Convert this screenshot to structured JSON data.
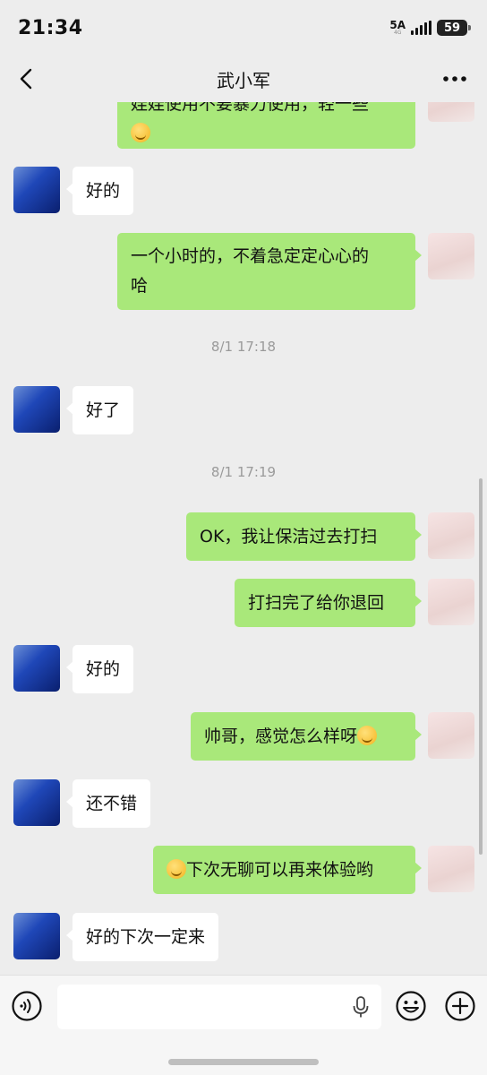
{
  "status_bar": {
    "time": "21:34",
    "network": "5A",
    "network_sub": "4G",
    "battery": "59"
  },
  "header": {
    "title": "武小军"
  },
  "messages": [
    {
      "dir": "out",
      "text": "娃娃使用不要暴力使用，轻一些"
    },
    {
      "dir": "in",
      "text": "好的"
    },
    {
      "dir": "out",
      "line1": "一个小时的，不着急定定心心的",
      "line2": "哈"
    },
    {
      "time": "8/1 17:18"
    },
    {
      "dir": "in",
      "text": "好了"
    },
    {
      "time": "8/1 17:19"
    },
    {
      "dir": "out",
      "text": "OK，我让保洁过去打扫"
    },
    {
      "dir": "out",
      "text": "打扫完了给你退回"
    },
    {
      "dir": "in",
      "text": "好的"
    },
    {
      "dir": "out",
      "text": "帅哥，感觉怎么样呀"
    },
    {
      "dir": "in",
      "text": "还不错"
    },
    {
      "dir": "out",
      "text": "下次无聊可以再来体验哟"
    },
    {
      "dir": "in",
      "text": "好的下次一定来"
    }
  ],
  "icons": {
    "back": "chevron-left-icon",
    "more": "more-icon",
    "voice": "voice-icon",
    "mic": "mic-icon",
    "emoji": "emoji-icon",
    "plus": "plus-icon"
  },
  "colors": {
    "background": "#ededed",
    "bubble_out": "#a9e87a",
    "bubble_in": "#ffffff",
    "timestamp": "#9a9a9a"
  }
}
